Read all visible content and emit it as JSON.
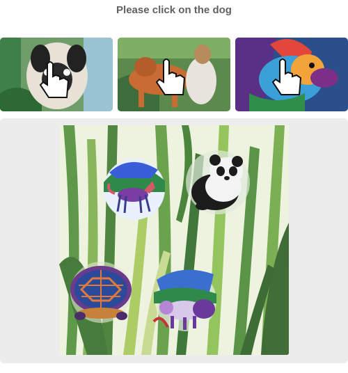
{
  "prompt": "Please click on the dog",
  "examples": [
    {
      "icon": "pug-dog-image"
    },
    {
      "icon": "brown-dog-image"
    },
    {
      "icon": "colorful-dog-image"
    }
  ],
  "challenge": {
    "targets": [
      {
        "icon": "fox-image"
      },
      {
        "icon": "panda-image"
      },
      {
        "icon": "turtle-image"
      },
      {
        "icon": "cow-image"
      }
    ]
  },
  "footer": {
    "left_text": "",
    "right_text": ""
  },
  "colors": {
    "panel_bg": "#ececec",
    "prompt_text": "#616161"
  }
}
